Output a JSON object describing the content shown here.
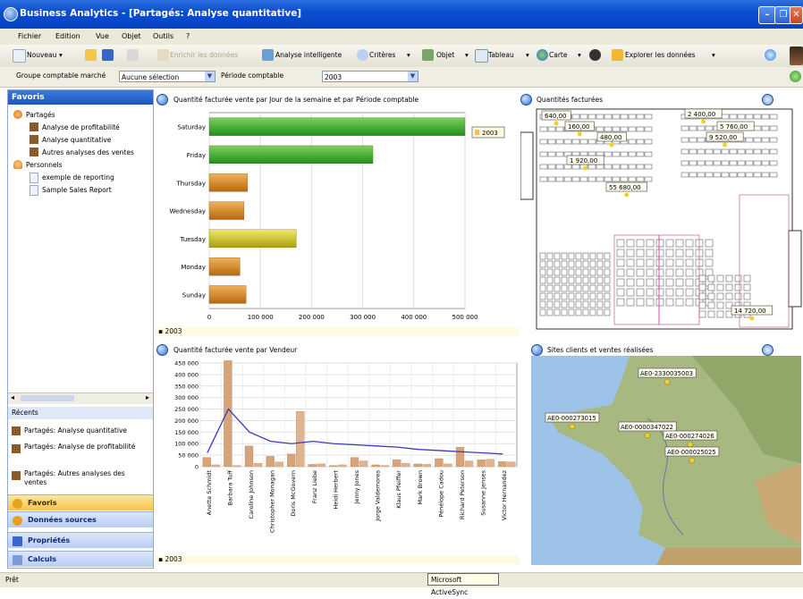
{
  "window": {
    "title": "Business Analytics - [Partagés: Analyse quantitative]"
  },
  "menu": [
    "Fichier",
    "Edition",
    "Vue",
    "Objet",
    "Outils",
    "?"
  ],
  "toolbar": {
    "nouveau": "Nouveau",
    "enrichir": "Enrichir les données",
    "analyse": "Analyse intelligente",
    "criteres": "Critères",
    "objet": "Objet",
    "tableau": "Tableau",
    "carte": "Carte",
    "explorer": "Explorer les données"
  },
  "filters": {
    "groupe_label": "Groupe comptable marché",
    "groupe_value": "Aucune sélection",
    "periode_label": "Période comptable",
    "periode_value": "2003"
  },
  "left": {
    "header": "Favoris",
    "shared_label": "Partagés",
    "shared_items": [
      "Analyse de profitabilité",
      "Analyse quantitative",
      "Autres analyses des ventes"
    ],
    "personal_label": "Personnels",
    "personal_items": [
      "exemple de reporting",
      "Sample Sales Report"
    ],
    "recent_label": "Récents",
    "recent_items": [
      "Partagés: Analyse quantitative",
      "Partagés: Analyse de profitabilité",
      "Partagés: Autres analyses des ventes"
    ],
    "nav": [
      "Favoris",
      "Données sources",
      "Propriétés",
      "Calculs"
    ]
  },
  "panels": {
    "bar_title": "Quantité facturée vente par Jour de la semaine et par Période comptable",
    "map_title": "Quantités facturées",
    "vendor_title": "Quantité facturée vente par Vendeur",
    "geo_title": "Sites clients et ventes réalisées",
    "footer_year": "2003"
  },
  "floorplan_labels": [
    "640,00",
    "160,00",
    "2 400,00",
    "5 760,00",
    "480,00",
    "9 520,00",
    "1 920,00",
    "55 680,00",
    "14 720,00"
  ],
  "geo_labels": [
    "AE0-2330035003",
    "AE0-000273015",
    "AE0-0000347022",
    "AE0-000274026",
    "AE0-000025025"
  ],
  "status": {
    "ready": "Prêt",
    "activesync": "Microsoft ActiveSync"
  },
  "colors": {
    "green_bar": "#1f8f1f",
    "orange_bar": "#d2861c",
    "olive_bar": "#c9c21c",
    "hist_bar": "#d6a47a",
    "trend_line": "#3b3bbf"
  },
  "chart_data": [
    {
      "type": "bar",
      "title": "Quantité facturée vente par Jour de la semaine et par Période comptable",
      "orientation": "horizontal",
      "categories": [
        "Saturday",
        "Friday",
        "Thursday",
        "Wednesday",
        "Tuesday",
        "Monday",
        "Sunday"
      ],
      "series": [
        {
          "name": "2003",
          "values": [
            500000,
            320000,
            75000,
            68000,
            170000,
            60000,
            72000
          ]
        }
      ],
      "xlim": [
        0,
        500000
      ],
      "xticks": [
        "0",
        "100 000",
        "200 000",
        "300 000",
        "400 000",
        "500 000"
      ],
      "legend": "right",
      "grid": true
    },
    {
      "type": "bar",
      "title": "Quantité facturée vente par Vendeur",
      "categories": [
        "Anette Schmidt",
        "Barbara Tuff",
        "Caroline Johnson",
        "Christopher Monagan",
        "Doris McGovern",
        "Franz Liebe",
        "Heidi Herbert",
        "Jenny Jones",
        "Jorge Valdemoros",
        "Klaus Pfeiffer",
        "Mark Brown",
        "Pénélope Cadou",
        "Richard Peterson",
        "Susanne Jenses",
        "Victor Hernandez"
      ],
      "bars": [
        40000,
        460000,
        90000,
        45000,
        55000,
        10000,
        5000,
        40000,
        8000,
        30000,
        12000,
        35000,
        85000,
        30000,
        22000
      ],
      "extra_bars": [
        8000,
        5000,
        15000,
        20000,
        240000,
        12000,
        8000,
        25000,
        5000,
        15000,
        10000,
        12000,
        25000,
        32000,
        20000
      ],
      "trend": [
        60000,
        250000,
        150000,
        110000,
        100000,
        110000,
        100000,
        95000,
        90000,
        85000,
        75000,
        70000,
        65000,
        60000,
        55000
      ],
      "ylim": [
        0,
        450000
      ],
      "yticks": [
        "0",
        "50 000",
        "100 000",
        "150 000",
        "200 000",
        "250 000",
        "300 000",
        "350 000",
        "400 000",
        "450 000"
      ],
      "grid": true
    }
  ]
}
